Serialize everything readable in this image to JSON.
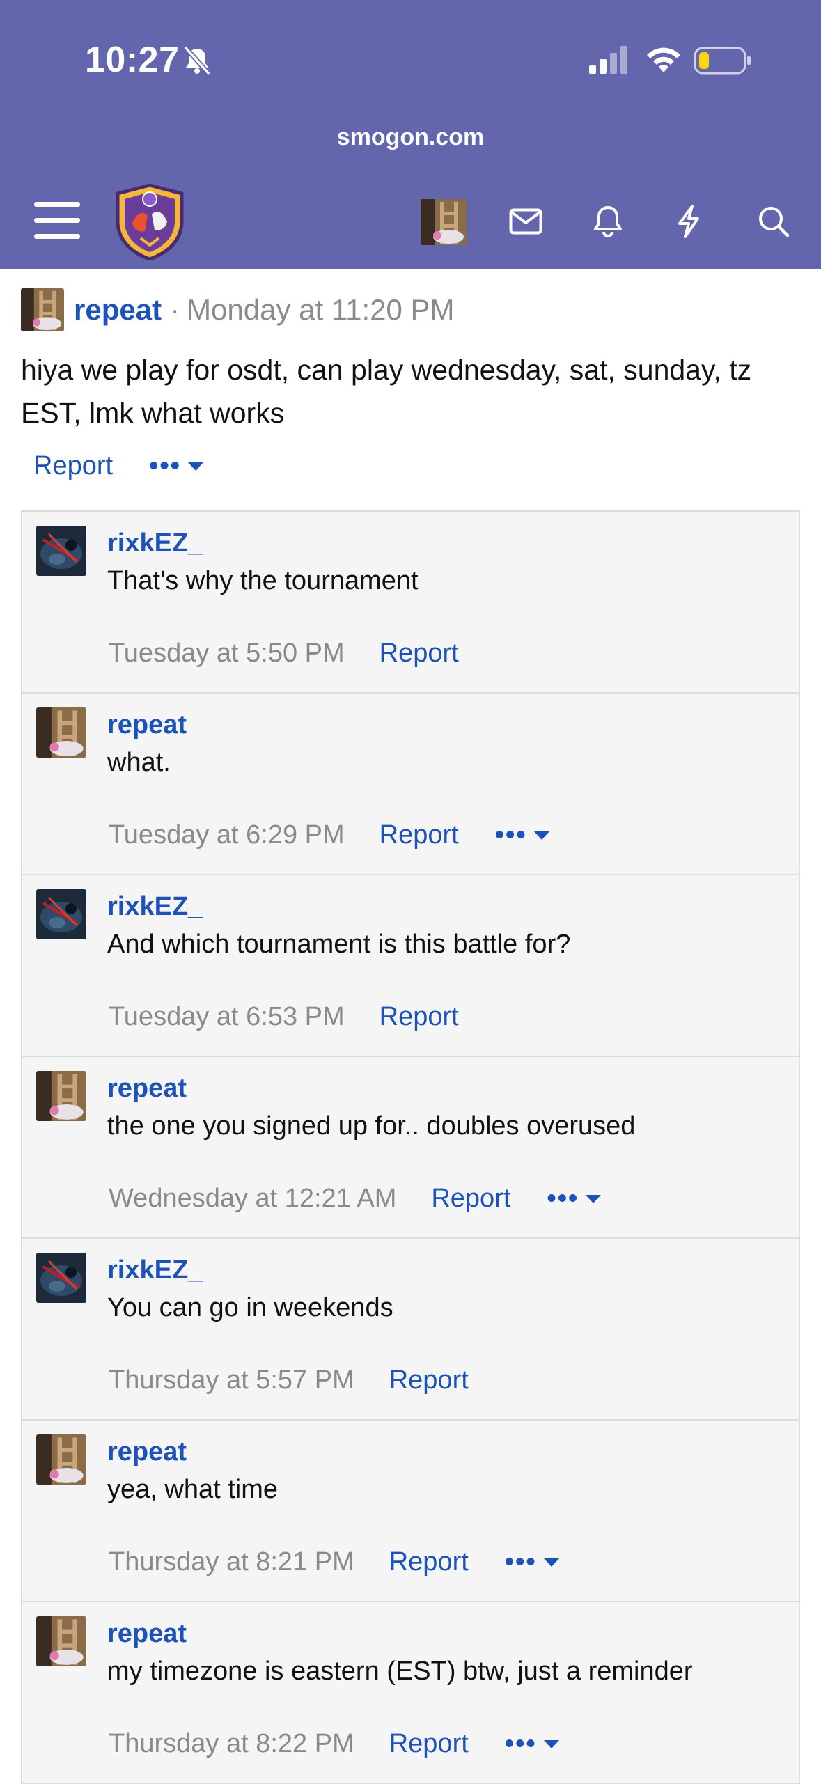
{
  "status_bar": {
    "time": "10:27"
  },
  "browser": {
    "url": "smogon.com"
  },
  "nav": {
    "icons": [
      "menu-icon",
      "site-logo",
      "user-avatar",
      "mail-icon",
      "bell-icon",
      "bolt-icon",
      "search-icon"
    ]
  },
  "colors": {
    "header_bg": "#6466ad",
    "link": "#1d52b8",
    "muted": "#8a8a8a",
    "comment_bg": "#f5f5f5"
  },
  "post": {
    "author": "repeat",
    "separator": "·",
    "date": "Monday at 11:20 PM",
    "body": "hiya we play for osdt, can play wednesday, sat, sunday, tz EST, lmk what works",
    "report_label": "Report",
    "more_label": "•••"
  },
  "comments": [
    {
      "author": "rixkEZ_",
      "text": "That's why the tournament",
      "date": "Tuesday at 5:50 PM",
      "report": "Report",
      "more": ""
    },
    {
      "author": "repeat",
      "text": "what.",
      "date": "Tuesday at 6:29 PM",
      "report": "Report",
      "more": "•••"
    },
    {
      "author": "rixkEZ_",
      "text": "And which tournament is this battle for?",
      "date": "Tuesday at 6:53 PM",
      "report": "Report",
      "more": ""
    },
    {
      "author": "repeat",
      "text": "the one you signed up for.. doubles overused",
      "date": "Wednesday at 12:21 AM",
      "report": "Report",
      "more": "•••"
    },
    {
      "author": "rixkEZ_",
      "text": "You can go in weekends",
      "date": "Thursday at 5:57 PM",
      "report": "Report",
      "more": ""
    },
    {
      "author": "repeat",
      "text": "yea, what time",
      "date": "Thursday at 8:21 PM",
      "report": "Report",
      "more": "•••"
    },
    {
      "author": "repeat",
      "text": "my timezone is eastern (EST) btw, just a reminder",
      "date": "Thursday at 8:22 PM",
      "report": "Report",
      "more": "•••"
    }
  ]
}
